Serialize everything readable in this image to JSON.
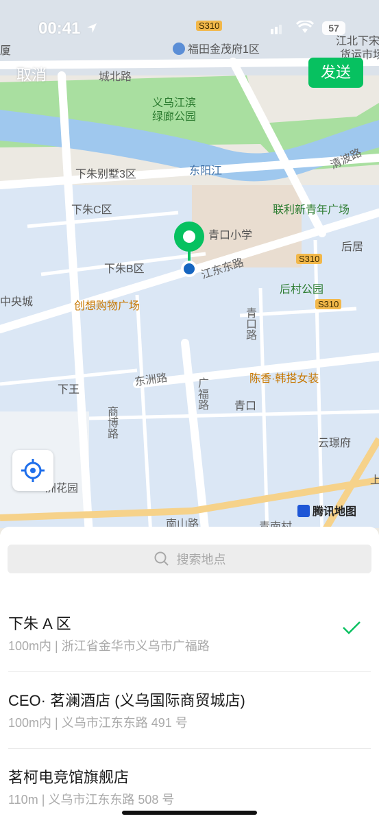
{
  "status_bar": {
    "time": "00:41",
    "battery": "57"
  },
  "header": {
    "cancel_label": "取消",
    "send_label": "发送"
  },
  "map": {
    "labels": {
      "s310_a": "S310",
      "futian": "福田金茂府1区",
      "jiangbei": "江北下宋",
      "jiangbei2": "货运市场",
      "xia": "厦",
      "chengbei": "城北路",
      "park1": "义乌江滨",
      "park2": "绿廊公园",
      "xiazhu_villa": "下朱别墅3区",
      "dongyang": "东阳江",
      "qingbo": "清波路",
      "xiazhu_c": "下朱C区",
      "lianli": "联利新青年广场",
      "qingkou_school": "青口小学",
      "houju": "后居",
      "xiazhu_b": "下朱B区",
      "jiangdong": "江东东路",
      "s310_b": "S310",
      "zhongyang": "中央城",
      "chuangxiang": "创想购物广场",
      "houcun": "后村公园",
      "s310_c": "S310",
      "qingkou_road": "青口路",
      "chenxiang": "陈香·韩搭女装",
      "dongzhou": "东洲路",
      "xiawang": "下王",
      "guangfu": "广福路",
      "qingkou": "青口",
      "shangbo": "商博路",
      "yunjing": "云璟府",
      "huayuan": "洲花园",
      "nanshan": "南山路",
      "qingnancun": "青南村",
      "shang": "上"
    },
    "brand": "腾讯地图",
    "pin_color": "#07c160",
    "location_color": "#1565c0"
  },
  "search": {
    "placeholder": "搜索地点"
  },
  "results": [
    {
      "title": "下朱 A 区",
      "subtitle": "100m内 | 浙江省金华市义乌市广福路",
      "selected": true
    },
    {
      "title": "CEO· 茗澜酒店 (义乌国际商贸城店)",
      "subtitle": "100m内 | 义乌市江东东路 491 号",
      "selected": false
    },
    {
      "title": "茗柯电竞馆旗舰店",
      "subtitle": "110m | 义乌市江东东路 508 号",
      "selected": false
    }
  ],
  "colors": {
    "accent": "#07c160",
    "water": "#9fc8ee",
    "park": "#a9dfa0",
    "block": "#dce9f7"
  }
}
